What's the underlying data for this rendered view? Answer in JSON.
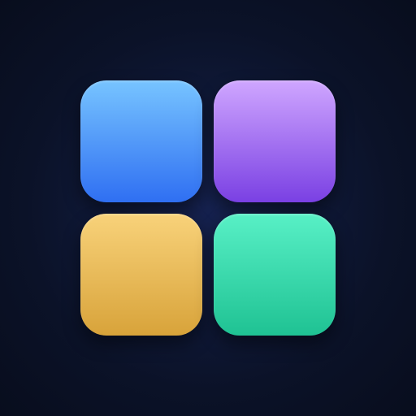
{
  "icon": {
    "background_colors": [
      "#162250",
      "#080d1d"
    ],
    "tiles": [
      {
        "name": "blue",
        "color_top": "#77c4ff",
        "color_bottom": "#2f6ff2"
      },
      {
        "name": "purple",
        "color_top": "#cfa6ff",
        "color_bottom": "#7a40e3"
      },
      {
        "name": "gold",
        "color_top": "#f8d27a",
        "color_bottom": "#d8a33a"
      },
      {
        "name": "green",
        "color_top": "#58f0c6",
        "color_bottom": "#1fc293"
      }
    ]
  }
}
